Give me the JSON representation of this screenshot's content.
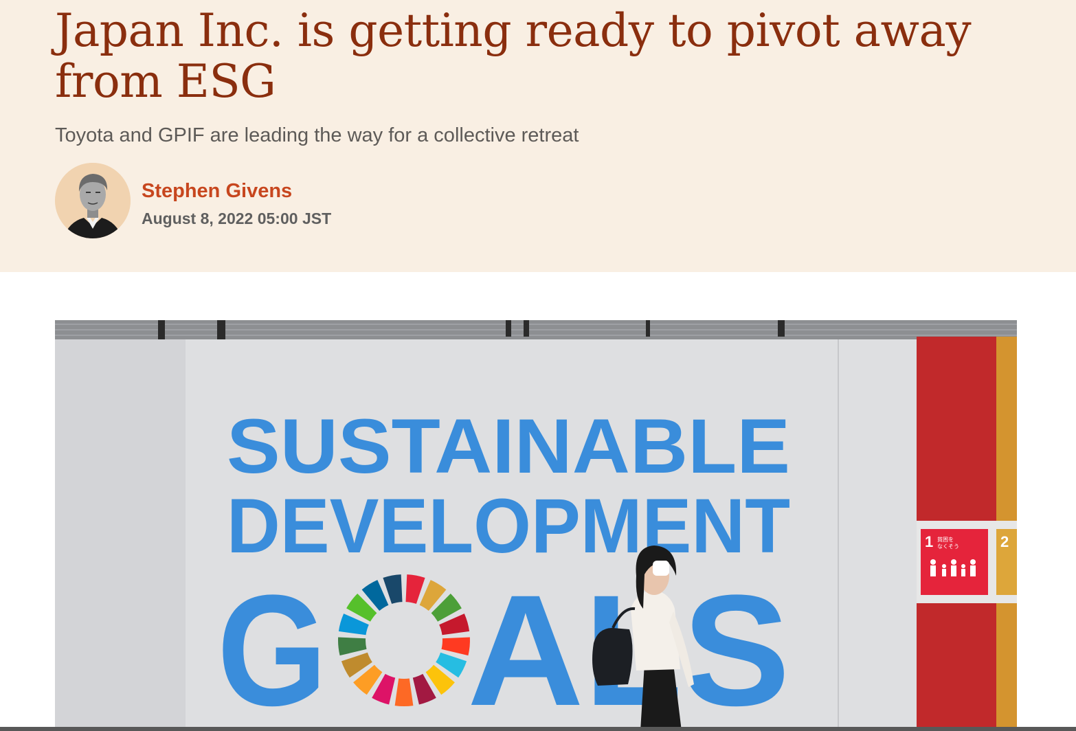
{
  "article": {
    "headline": "Japan Inc. is getting ready to pivot away from ESG",
    "subtitle": "Toyota and GPIF are leading the way for a collective retreat",
    "author": "Stephen Givens",
    "date": "August 8, 2022 05:00 JST"
  },
  "hero_image": {
    "sign_line1": "SUSTAINABLE",
    "sign_line2": "DEVELOPMENT",
    "sign_goals_g": "G",
    "sign_goals_rest": "ALS",
    "goal1_number": "1",
    "goal1_text_a": "貧困を",
    "goal1_text_b": "なくそう",
    "goal2_number": "2",
    "colors": {
      "sign_blue": "#3a8ddb",
      "goal1_red": "#e5243b",
      "goal2_mustard": "#dda63a"
    }
  },
  "colors": {
    "header_bg": "#f9efe3",
    "headline": "#8a2e0e",
    "author": "#c7461e"
  }
}
